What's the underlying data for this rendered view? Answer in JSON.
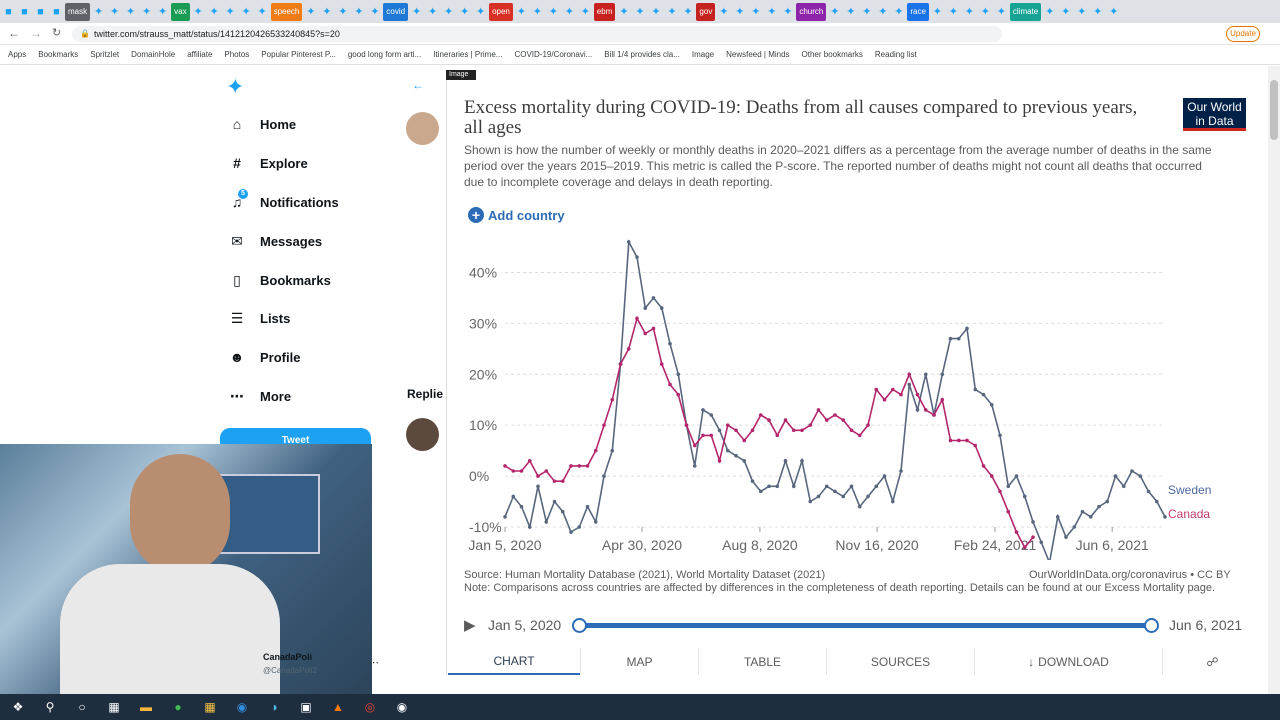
{
  "browser": {
    "tabs": [
      "mask",
      "vax",
      "speech",
      "covid",
      "open",
      "ebm",
      "gov",
      "church",
      "race",
      "climate"
    ],
    "tab_colors": [
      "#5f6368",
      "#1a9c54",
      "#f07c17",
      "#1d78d6",
      "#d93025",
      "#c7221f",
      "#c5221f",
      "#8e24aa",
      "#1a73e8",
      "#16a394"
    ],
    "url": "twitter.com/strauss_matt/status/1412120426533240845?s=20",
    "update_label": "Update",
    "bookmarks": [
      "Apps",
      "Bookmarks",
      "Spritzlet",
      "DomainHole",
      "affiliate",
      "Photos",
      "Popular Pinterest P...",
      "good long form arti...",
      "Itineraries | Prime...",
      "COVID-19/Coronavi...",
      "Bill 1/4 provides cla...",
      "Image",
      "Newsfeed | Minds",
      "Other bookmarks",
      "Reading list"
    ]
  },
  "twitter": {
    "nav": {
      "home": "Home",
      "explore": "Explore",
      "notifications": "Notifications",
      "notifications_badge": "5",
      "messages": "Messages",
      "bookmarks": "Bookmarks",
      "lists": "Lists",
      "profile": "Profile",
      "more": "More"
    },
    "tweet_button": "Tweet",
    "replies_label": "Replie",
    "account_name": "CanadaPoli",
    "account_handle": "@CanadaPoli2",
    "image_label": "Image",
    "messages_label": "Messages"
  },
  "chart": {
    "title": "Excess mortality during COVID-19: Deaths from all causes compared to previous years, all ages",
    "logo_line1": "Our World",
    "logo_line2": "in Data",
    "subtitle": "Shown is how the number of weekly or monthly deaths in 2020–2021 differs as a percentage from the average number of deaths in the same period over the years 2015–2019. This metric is called the P-score. The reported number of deaths might not count all deaths that occurred due to incomplete coverage and delays in death reporting.",
    "add_country": "Add country",
    "source": "Source: Human Mortality Database (2021), World Mortality Dataset (2021)",
    "license": "OurWorldInData.org/coronavirus • CC BY",
    "note": "Note: Comparisons across countries are affected by differences in the completeness of death reporting. Details can be found at our Excess Mortality page.",
    "timeline_start": "Jan 5, 2020",
    "timeline_end": "Jun 6, 2021",
    "tabs": [
      "CHART",
      "MAP",
      "TABLE",
      "SOURCES",
      "DOWNLOAD"
    ]
  },
  "chart_data": {
    "type": "line",
    "ylim": [
      -10,
      45
    ],
    "yticks": [
      "40%",
      "30%",
      "20%",
      "10%",
      "0%",
      "-10%"
    ],
    "ytick_values": [
      40,
      30,
      20,
      10,
      0,
      -10
    ],
    "xticks": [
      "Jan 5, 2020",
      "Apr 30, 2020",
      "Aug 8, 2020",
      "Nov 16, 2020",
      "Feb 24, 2021",
      "Jun 6, 2021"
    ],
    "xtick_weeks": [
      0,
      16.6,
      30.9,
      45.1,
      59.4,
      73.6
    ],
    "grid": true,
    "series": [
      {
        "name": "Sweden",
        "color": "#58677e",
        "values": [
          -8,
          -4,
          -6,
          -10,
          -2,
          -9,
          -5,
          -7,
          -11,
          -10,
          -6,
          -9,
          0,
          5,
          22,
          46,
          43,
          33,
          35,
          33,
          26,
          20,
          10,
          2,
          13,
          12,
          9,
          5,
          4,
          3,
          -1,
          -3,
          -2,
          -2,
          3,
          -2,
          3,
          -5,
          -4,
          -2,
          -3,
          -4,
          -2,
          -6,
          -4,
          -2,
          0,
          -5,
          1,
          18,
          13,
          20,
          12,
          20,
          27,
          27,
          29,
          17,
          16,
          14,
          8,
          -2,
          0,
          -4,
          -9,
          -13,
          -17,
          -8,
          -12,
          -10,
          -7,
          -8,
          -6,
          -5,
          0,
          -2,
          1,
          0,
          -3,
          -5,
          -8
        ],
        "label_color": "#4c6a9c"
      },
      {
        "name": "Canada",
        "color": "#b4266b",
        "values": [
          2,
          1,
          1,
          3,
          0,
          1,
          -1,
          -1,
          2,
          2,
          2,
          5,
          10,
          15,
          22,
          25,
          31,
          28,
          29,
          22,
          18,
          16,
          10,
          6,
          8,
          8,
          3,
          10,
          9,
          7,
          9,
          12,
          11,
          8,
          11,
          9,
          9,
          10,
          13,
          11,
          12,
          11,
          9,
          8,
          10,
          17,
          15,
          17,
          16,
          20,
          16,
          13,
          12,
          15,
          7,
          7,
          7,
          6,
          2,
          0,
          -3,
          -7,
          -11,
          -14,
          -12
        ],
        "label_color": "#c03a6e"
      }
    ]
  }
}
